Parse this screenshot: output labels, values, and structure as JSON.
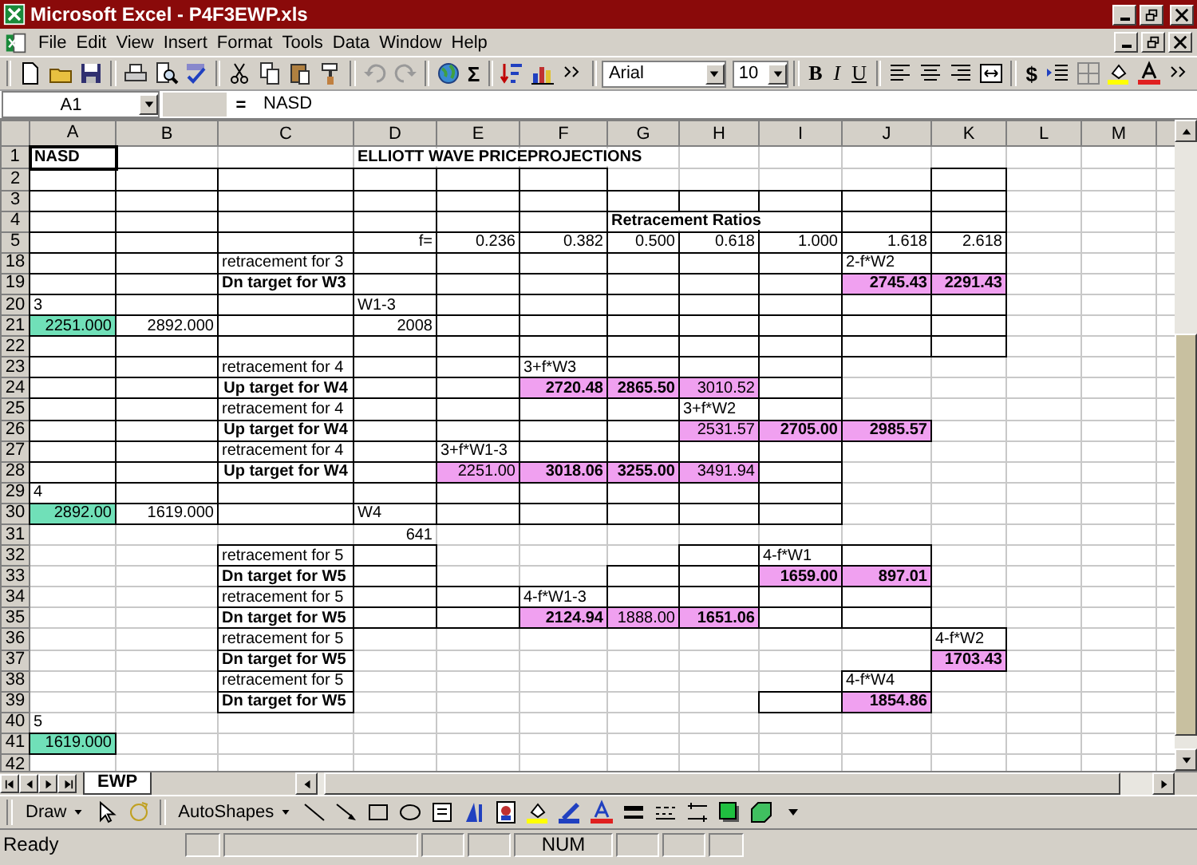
{
  "window": {
    "title": "Microsoft Excel - P4F3EWP.xls"
  },
  "menu": [
    "File",
    "Edit",
    "View",
    "Insert",
    "Format",
    "Tools",
    "Data",
    "Window",
    "Help"
  ],
  "toolbar": {
    "sum": "Σ",
    "font": "Arial",
    "size": "10",
    "format_buttons": [
      "B",
      "I",
      "U"
    ],
    "currency": "$"
  },
  "formula_bar": {
    "name_box": "A1",
    "equals": "=",
    "value": "NASD"
  },
  "columns": [
    "A",
    "B",
    "C",
    "D",
    "E",
    "F",
    "G",
    "H",
    "I",
    "J",
    "K",
    "L",
    "M"
  ],
  "rows": [
    {
      "number": "1",
      "cells": [
        {
          "text": "NASD",
          "bold": true,
          "selected": true
        },
        {},
        {},
        {
          "text": "ELLIOTT WAVE PRICEPROJECTIONS",
          "bold": true
        },
        {},
        {},
        {},
        {},
        {},
        {},
        {},
        {},
        {}
      ]
    },
    {
      "number": "2",
      "cells": [
        {
          "boxed": true
        },
        {
          "boxed": true
        },
        {
          "boxed": true
        },
        {
          "boxed": true
        },
        {
          "boxed": true
        },
        {
          "boxed": true
        },
        {},
        {},
        {},
        {},
        {
          "boxed": true
        },
        {},
        {}
      ]
    },
    {
      "number": "3",
      "cells": [
        {
          "boxed": true
        },
        {
          "boxed": true
        },
        {
          "boxed": true
        },
        {
          "boxed": true
        },
        {
          "boxed": true
        },
        {
          "boxed": true
        },
        {
          "boxed": true
        },
        {
          "boxed": true
        },
        {
          "boxed": true
        },
        {
          "boxed": true
        },
        {
          "boxed": true
        },
        {},
        {}
      ]
    },
    {
      "number": "4",
      "cells": [
        {
          "boxed": true
        },
        {
          "boxed": true
        },
        {
          "boxed": true
        },
        {
          "boxed": true
        },
        {
          "boxed": true
        },
        {
          "boxed": true
        },
        {
          "text": "Retracement Ratios",
          "bold": true
        },
        {},
        {
          "boxed": true
        },
        {
          "boxed": true
        },
        {
          "boxed": true
        },
        {},
        {}
      ]
    },
    {
      "number": "5",
      "cells": [
        {
          "boxed": true
        },
        {
          "boxed": true
        },
        {
          "boxed": true
        },
        {
          "text": "f=",
          "right_aligned": true,
          "boxed": true
        },
        {
          "text": "0.236",
          "right_aligned": true,
          "boxed": true
        },
        {
          "text": "0.382",
          "right_aligned": true,
          "boxed": true
        },
        {
          "text": "0.500",
          "right_aligned": true,
          "boxed": true
        },
        {
          "text": "0.618",
          "right_aligned": true,
          "boxed": true
        },
        {
          "text": "1.000",
          "right_aligned": true,
          "boxed": true
        },
        {
          "text": "1.618",
          "right_aligned": true,
          "boxed": true
        },
        {
          "text": "2.618",
          "right_aligned": true,
          "boxed": true
        },
        {},
        {}
      ]
    },
    {
      "number": "18",
      "cells": [
        {
          "boxed": true
        },
        {
          "boxed": true
        },
        {
          "text": "retracement for 3",
          "boxed": true
        },
        {
          "boxed": true
        },
        {
          "boxed": true
        },
        {
          "boxed": true
        },
        {
          "boxed": true
        },
        {
          "boxed": true
        },
        {
          "boxed": true
        },
        {
          "text": "2-f*W2",
          "boxed": true
        },
        {
          "boxed": true
        },
        {},
        {}
      ]
    },
    {
      "number": "19",
      "cells": [
        {
          "boxed": true
        },
        {
          "boxed": true
        },
        {
          "text": "Dn target for W3",
          "bold": true,
          "boxed": true
        },
        {
          "boxed": true
        },
        {
          "boxed": true
        },
        {
          "boxed": true
        },
        {
          "boxed": true
        },
        {
          "boxed": true
        },
        {
          "boxed": true
        },
        {
          "text": "2745.43",
          "bold": true,
          "right_aligned": true,
          "color": "#f0a0f0",
          "boxed": true
        },
        {
          "text": "2291.43",
          "bold": true,
          "right_aligned": true,
          "color": "#f0a0f0",
          "boxed": true
        },
        {},
        {}
      ]
    },
    {
      "number": "20",
      "cells": [
        {
          "text": "3",
          "boxed": true
        },
        {
          "boxed": true
        },
        {
          "boxed": true
        },
        {
          "text": "W1-3",
          "boxed": true
        },
        {
          "boxed": true
        },
        {
          "boxed": true
        },
        {
          "boxed": true
        },
        {
          "boxed": true
        },
        {
          "boxed": true
        },
        {
          "boxed": true
        },
        {
          "boxed": true
        },
        {},
        {}
      ]
    },
    {
      "number": "21",
      "cells": [
        {
          "text": "2251.000",
          "right_aligned": true,
          "color": "#70e0b8",
          "boxed": true
        },
        {
          "text": "2892.000",
          "right_aligned": true,
          "boxed": true
        },
        {
          "boxed": true
        },
        {
          "text": "2008",
          "right_aligned": true,
          "boxed": true
        },
        {
          "boxed": true
        },
        {
          "boxed": true
        },
        {
          "boxed": true
        },
        {
          "boxed": true
        },
        {
          "boxed": true
        },
        {
          "boxed": true
        },
        {
          "boxed": true
        },
        {},
        {}
      ]
    },
    {
      "number": "22",
      "cells": [
        {
          "boxed": true
        },
        {
          "boxed": true
        },
        {
          "boxed": true
        },
        {
          "boxed": true
        },
        {
          "boxed": true
        },
        {
          "boxed": true
        },
        {
          "boxed": true
        },
        {
          "boxed": true
        },
        {
          "boxed": true
        },
        {
          "boxed": true
        },
        {
          "boxed": true
        },
        {},
        {}
      ]
    },
    {
      "number": "23",
      "cells": [
        {
          "boxed": true
        },
        {
          "boxed": true
        },
        {
          "text": "retracement for 4",
          "boxed": true
        },
        {
          "boxed": true
        },
        {
          "boxed": true
        },
        {
          "text": "3+f*W3",
          "boxed": true
        },
        {
          "boxed": true
        },
        {
          "boxed": true
        },
        {
          "boxed": true
        },
        {},
        {},
        {},
        {}
      ]
    },
    {
      "number": "24",
      "cells": [
        {
          "boxed": true
        },
        {
          "boxed": true
        },
        {
          "text": "Up target for W4",
          "bold": true,
          "centered": true,
          "boxed": true
        },
        {
          "boxed": true
        },
        {
          "boxed": true
        },
        {
          "text": "2720.48",
          "bold": true,
          "right_aligned": true,
          "color": "#f0a0f0",
          "boxed": true
        },
        {
          "text": "2865.50",
          "bold": true,
          "right_aligned": true,
          "color": "#f0a0f0",
          "boxed": true
        },
        {
          "text": "3010.52",
          "right_aligned": true,
          "color": "#f0a0f0",
          "boxed": true
        },
        {
          "boxed": true
        },
        {},
        {},
        {},
        {}
      ]
    },
    {
      "number": "25",
      "cells": [
        {
          "boxed": true
        },
        {
          "boxed": true
        },
        {
          "text": "retracement for 4",
          "boxed": true
        },
        {
          "boxed": true
        },
        {
          "boxed": true
        },
        {
          "boxed": true
        },
        {
          "boxed": true
        },
        {
          "text": "3+f*W2",
          "boxed": true
        },
        {
          "boxed": true
        },
        {},
        {},
        {},
        {}
      ]
    },
    {
      "number": "26",
      "cells": [
        {
          "boxed": true
        },
        {
          "boxed": true
        },
        {
          "text": "Up target for W4",
          "bold": true,
          "centered": true,
          "boxed": true
        },
        {
          "boxed": true
        },
        {
          "boxed": true
        },
        {
          "boxed": true
        },
        {
          "boxed": true
        },
        {
          "text": "2531.57",
          "right_aligned": true,
          "color": "#f0a0f0",
          "boxed": true
        },
        {
          "text": "2705.00",
          "bold": true,
          "right_aligned": true,
          "color": "#f0a0f0",
          "boxed": true
        },
        {
          "text": "2985.57",
          "bold": true,
          "right_aligned": true,
          "color": "#f0a0f0",
          "boxed": true
        },
        {},
        {},
        {}
      ]
    },
    {
      "number": "27",
      "cells": [
        {
          "boxed": true
        },
        {
          "boxed": true
        },
        {
          "text": "retracement for 4",
          "boxed": true
        },
        {
          "boxed": true
        },
        {
          "text": "3+f*W1-3",
          "boxed": true
        },
        {
          "boxed": true
        },
        {
          "boxed": true
        },
        {
          "boxed": true
        },
        {
          "boxed": true
        },
        {},
        {},
        {},
        {}
      ]
    },
    {
      "number": "28",
      "cells": [
        {
          "boxed": true
        },
        {
          "boxed": true
        },
        {
          "text": "Up target for W4",
          "bold": true,
          "centered": true,
          "boxed": true
        },
        {
          "boxed": true
        },
        {
          "text": "2251.00",
          "right_aligned": true,
          "color": "#f0a0f0",
          "boxed": true
        },
        {
          "text": "3018.06",
          "bold": true,
          "right_aligned": true,
          "color": "#f0a0f0",
          "boxed": true
        },
        {
          "text": "3255.00",
          "bold": true,
          "right_aligned": true,
          "color": "#f0a0f0",
          "boxed": true
        },
        {
          "text": "3491.94",
          "right_aligned": true,
          "color": "#f0a0f0",
          "boxed": true
        },
        {
          "boxed": true
        },
        {},
        {},
        {},
        {}
      ]
    },
    {
      "number": "29",
      "cells": [
        {
          "text": "4",
          "boxed": true
        },
        {
          "boxed": true
        },
        {
          "boxed": true
        },
        {
          "boxed": true
        },
        {
          "boxed": true
        },
        {
          "boxed": true
        },
        {
          "boxed": true
        },
        {
          "boxed": true
        },
        {
          "boxed": true
        },
        {},
        {},
        {},
        {}
      ]
    },
    {
      "number": "30",
      "cells": [
        {
          "text": "2892.00",
          "right_aligned": true,
          "color": "#70e0b8",
          "boxed": true
        },
        {
          "text": "1619.000",
          "right_aligned": true,
          "boxed": true
        },
        {
          "boxed": true
        },
        {
          "text": "W4",
          "boxed": true
        },
        {
          "boxed": true
        },
        {
          "boxed": true
        },
        {
          "boxed": true
        },
        {
          "boxed": true
        },
        {
          "boxed": true
        },
        {},
        {},
        {},
        {}
      ]
    },
    {
      "number": "31",
      "cells": [
        {},
        {},
        {},
        {
          "text": "641",
          "right_aligned": true
        },
        {},
        {},
        {},
        {},
        {},
        {},
        {},
        {},
        {}
      ]
    },
    {
      "number": "32",
      "cells": [
        {},
        {},
        {
          "text": "retracement for 5",
          "boxed": true
        },
        {
          "boxed": true
        },
        {},
        {},
        {},
        {
          "boxed": true
        },
        {
          "text": "4-f*W1",
          "boxed": true
        },
        {
          "boxed": true
        },
        {},
        {},
        {}
      ]
    },
    {
      "number": "33",
      "cells": [
        {},
        {},
        {
          "text": "Dn target for W5",
          "bold": true,
          "boxed": true
        },
        {
          "boxed": true
        },
        {},
        {},
        {
          "boxed": true
        },
        {
          "boxed": true
        },
        {
          "text": "1659.00",
          "bold": true,
          "right_aligned": true,
          "color": "#f0a0f0",
          "boxed": true
        },
        {
          "text": "897.01",
          "bold": true,
          "right_aligned": true,
          "color": "#f0a0f0",
          "boxed": true
        },
        {},
        {},
        {}
      ]
    },
    {
      "number": "34",
      "cells": [
        {},
        {},
        {
          "text": "retracement for 5",
          "boxed": true
        },
        {
          "boxed": true
        },
        {
          "boxed": true
        },
        {
          "text": "4-f*W1-3",
          "boxed": true
        },
        {
          "boxed": true
        },
        {
          "boxed": true
        },
        {
          "boxed": true
        },
        {
          "boxed": true
        },
        {},
        {},
        {}
      ]
    },
    {
      "number": "35",
      "cells": [
        {},
        {},
        {
          "text": "Dn target for W5",
          "bold": true,
          "boxed": true
        },
        {
          "boxed": true
        },
        {
          "boxed": true
        },
        {
          "text": "2124.94",
          "bold": true,
          "right_aligned": true,
          "color": "#f0a0f0",
          "boxed": true
        },
        {
          "text": "1888.00",
          "right_aligned": true,
          "color": "#f0a0f0",
          "boxed": true
        },
        {
          "text": "1651.06",
          "bold": true,
          "right_aligned": true,
          "color": "#f0a0f0",
          "boxed": true
        },
        {
          "boxed": true
        },
        {
          "boxed": true
        },
        {},
        {},
        {}
      ]
    },
    {
      "number": "36",
      "cells": [
        {},
        {},
        {
          "text": "retracement for 5",
          "boxed": true
        },
        {},
        {},
        {},
        {},
        {},
        {},
        {},
        {
          "text": "4-f*W2",
          "boxed": true
        },
        {},
        {}
      ]
    },
    {
      "number": "37",
      "cells": [
        {},
        {},
        {
          "text": "Dn target for W5",
          "bold": true,
          "boxed": true
        },
        {},
        {},
        {},
        {},
        {},
        {},
        {},
        {
          "text": "1703.43",
          "bold": true,
          "right_aligned": true,
          "color": "#f0a0f0",
          "boxed": true
        },
        {},
        {}
      ]
    },
    {
      "number": "38",
      "cells": [
        {},
        {},
        {
          "text": "retracement for 5",
          "boxed": true
        },
        {},
        {},
        {},
        {},
        {},
        {},
        {
          "text": "4-f*W4",
          "boxed": true
        },
        {},
        {},
        {}
      ]
    },
    {
      "number": "39",
      "cells": [
        {},
        {},
        {
          "text": "Dn target for W5",
          "bold": true,
          "boxed": true
        },
        {},
        {},
        {},
        {},
        {},
        {
          "boxed": true
        },
        {
          "text": "1854.86",
          "bold": true,
          "right_aligned": true,
          "color": "#f0a0f0",
          "boxed": true
        },
        {},
        {},
        {}
      ]
    },
    {
      "number": "40",
      "cells": [
        {
          "text": "5"
        },
        {},
        {},
        {},
        {},
        {},
        {},
        {},
        {},
        {},
        {},
        {},
        {}
      ]
    },
    {
      "number": "41",
      "cells": [
        {
          "text": "1619.000",
          "right_aligned": true,
          "color": "#70e0b8",
          "boxed": true
        },
        {},
        {},
        {},
        {},
        {},
        {},
        {},
        {},
        {},
        {},
        {},
        {}
      ]
    },
    {
      "number": "42",
      "cells": [
        {},
        {},
        {},
        {},
        {},
        {},
        {},
        {},
        {},
        {},
        {},
        {},
        {}
      ]
    }
  ],
  "sheet_tabs": [
    {
      "label": "EWP",
      "selected": true
    }
  ],
  "drawing_toolbar": {
    "draw": "Draw",
    "autoshapes": "AutoShapes"
  },
  "status_bar": {
    "text": "Ready",
    "num": "NUM"
  }
}
